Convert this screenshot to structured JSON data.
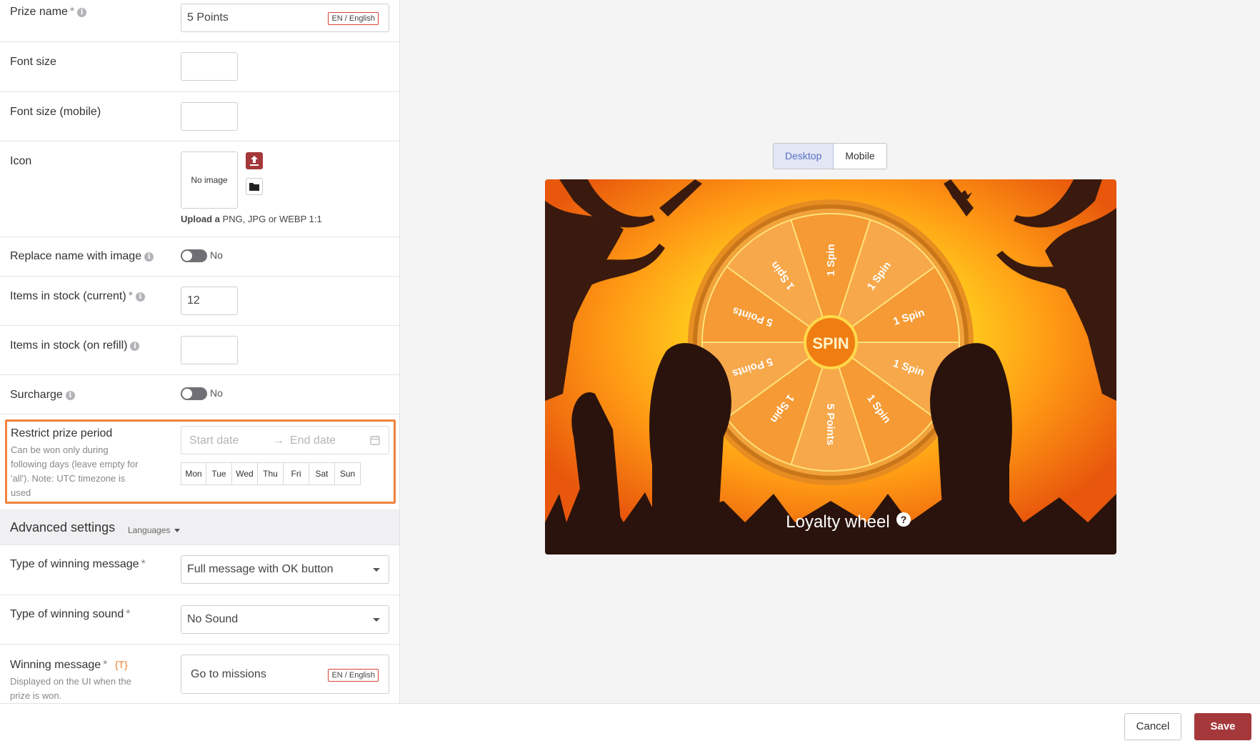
{
  "form": {
    "prize_name": {
      "label": "Prize name",
      "req": "*",
      "value": "5 Points",
      "lang": "EN / English"
    },
    "font_size": {
      "label": "Font size"
    },
    "font_size_mobile": {
      "label": "Font size (mobile)"
    },
    "icon": {
      "label": "Icon",
      "no_image": "No image",
      "upload_bold": "Upload a",
      "upload_hint": "PNG, JPG or WEBP 1:1",
      "upload_icon": "upload-icon",
      "folder_icon": "folder-icon"
    },
    "replace_name": {
      "label": "Replace name with image",
      "state": "No"
    },
    "stock_current": {
      "label": "Items in stock (current)",
      "req": "*",
      "value": "12"
    },
    "stock_refill": {
      "label": "Items in stock (on refill)"
    },
    "surcharge": {
      "label": "Surcharge",
      "state": "No"
    },
    "restrict_period": {
      "label": "Restrict prize period",
      "help": "Can be won only during following days (leave empty for 'all'). Note: UTC timezone is used",
      "start_placeholder": "Start date",
      "arrow": "→",
      "end_placeholder": "End date",
      "days": [
        "Mon",
        "Tue",
        "Wed",
        "Thu",
        "Fri",
        "Sat",
        "Sun"
      ]
    },
    "advanced": {
      "title": "Advanced settings",
      "languages": "Languages"
    },
    "winning_message_type": {
      "label": "Type of winning message",
      "req": "*",
      "value": "Full message with OK button"
    },
    "winning_sound_type": {
      "label": "Type of winning sound",
      "req": "*",
      "value": "No Sound"
    },
    "winning_message": {
      "label": "Winning message",
      "req": "*",
      "token": "{T}",
      "help": "Displayed on the UI when the prize is won.",
      "value": "Go to missions",
      "lang": "EN / English"
    }
  },
  "preview": {
    "tabs": [
      "Desktop",
      "Mobile"
    ],
    "active_tab": "Desktop",
    "wheel_segments": [
      "1 Spin",
      "1 Spin",
      "1 Spin",
      "1 Spin",
      "1 Spin",
      "5 Points",
      "1 Spin",
      "5 Points",
      "5 Points",
      "1 Spin"
    ],
    "spin_label": "SPIN",
    "title": "Loyalty wheel",
    "help_icon": "question-circle-icon",
    "colors": {
      "accent": "#ef7d2a",
      "save": "#a4383a",
      "highlight": "#f0823c"
    }
  },
  "footer": {
    "cancel": "Cancel",
    "save": "Save"
  }
}
